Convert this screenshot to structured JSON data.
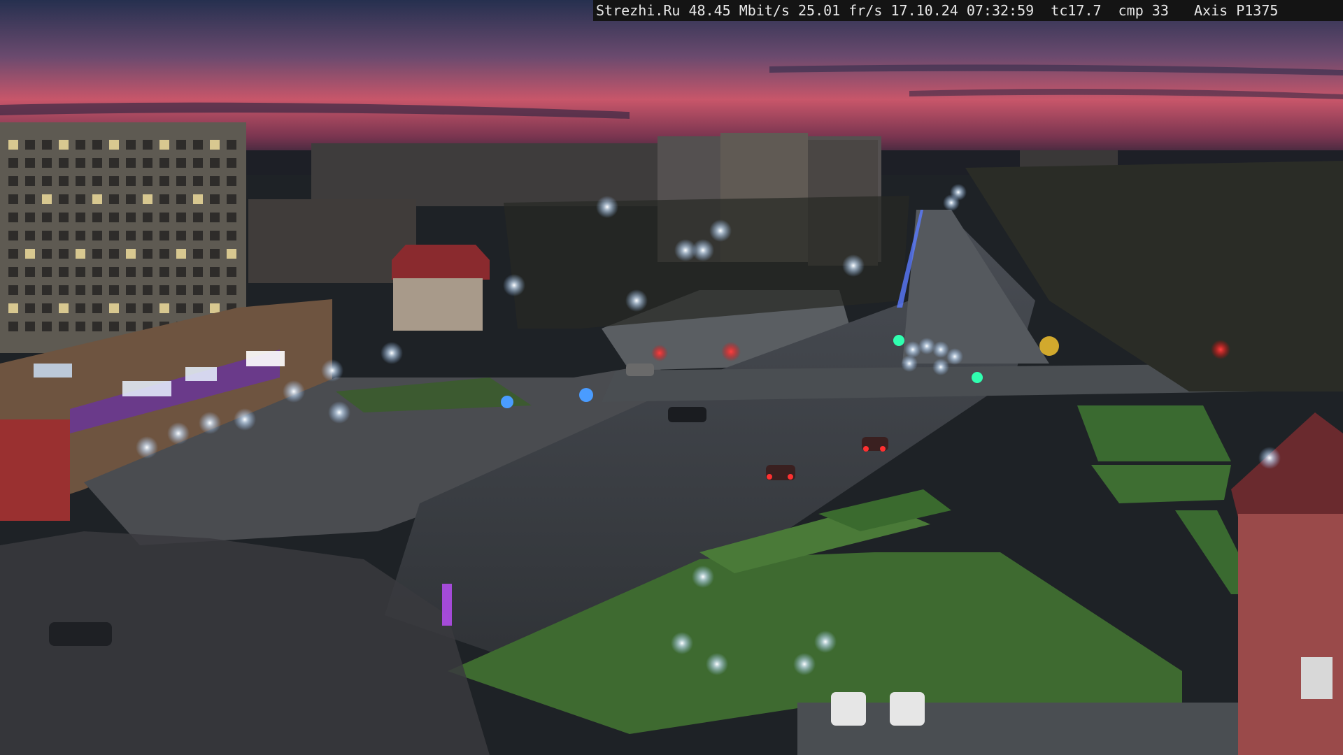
{
  "camera_overlay": {
    "site": "Strezhi.Ru",
    "bitrate": "48.45 Mbit/s",
    "framerate": "25.01 fr/s",
    "datetime": "17.10.24 07:32:59",
    "tc": "tc17.7",
    "cmp": "cmp 33",
    "model": "Axis P1375"
  },
  "scene": {
    "description_colors": {
      "sky_top": "#2e3a5c",
      "sky_band": "#c8566a",
      "horizon": "#5a2840",
      "ground": "#2a2d30",
      "grass": "#2f4a2a",
      "lamp": "#e8f4ff"
    }
  }
}
